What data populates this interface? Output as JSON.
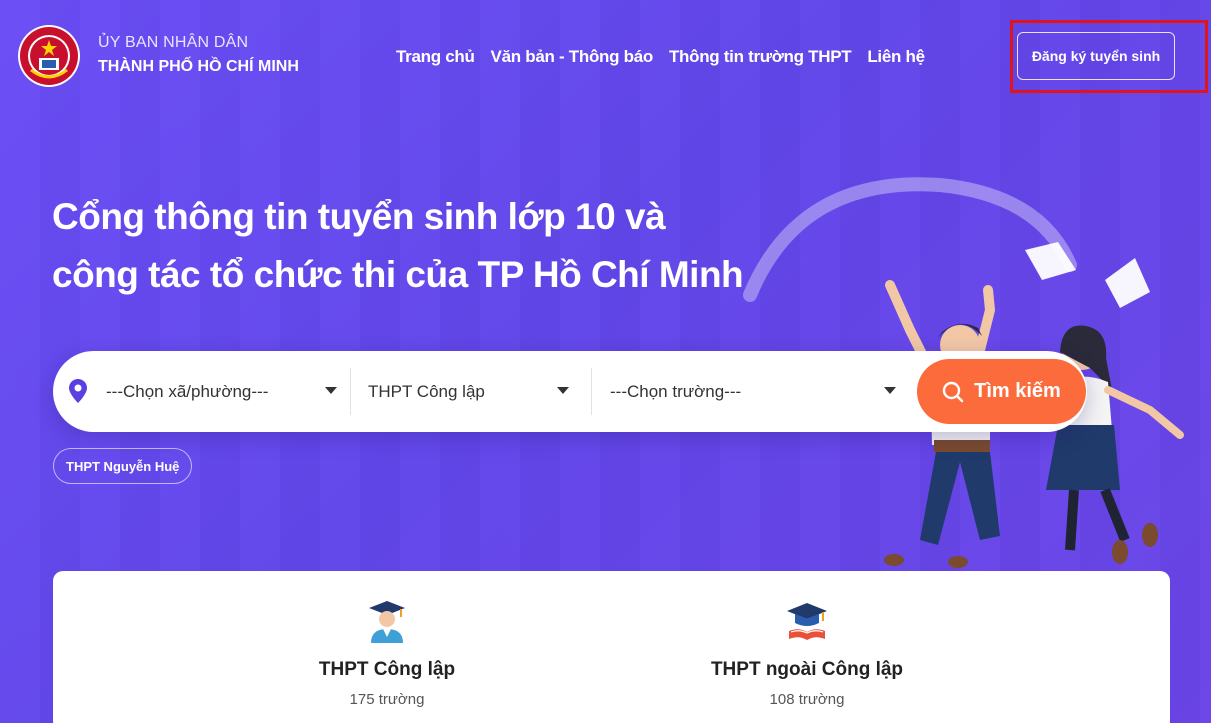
{
  "header": {
    "org_line1": "ỦY BAN NHÂN DÂN",
    "org_line2": "THÀNH PHỐ HỒ CHÍ MINH",
    "nav": [
      "Trang chủ",
      "Văn bản - Thông báo",
      "Thông tin trường THPT",
      "Liên hệ"
    ],
    "register_label": "Đăng ký tuyển sinh"
  },
  "hero": {
    "title_line1": "Cổng thông tin tuyển sinh lớp 10 và",
    "title_line2": "công tác tổ chức thi của TP Hồ Chí Minh"
  },
  "search": {
    "ward_value": "---Chọn xã/phường---",
    "type_value": "THPT Công lập",
    "school_value": "---Chọn trường---",
    "button_label": "Tìm kiếm",
    "recent_chip": "THPT Nguyễn Huệ"
  },
  "stats": [
    {
      "title": "THPT Công lập",
      "count": "175 trường",
      "icon": "student-graduate-icon"
    },
    {
      "title": "THPT ngoài Công lập",
      "count": "108 trường",
      "icon": "graduation-cap-book-icon"
    }
  ],
  "colors": {
    "background": "#6246ea",
    "accent": "#fb6b3c",
    "highlight_box": "#e0151b"
  }
}
